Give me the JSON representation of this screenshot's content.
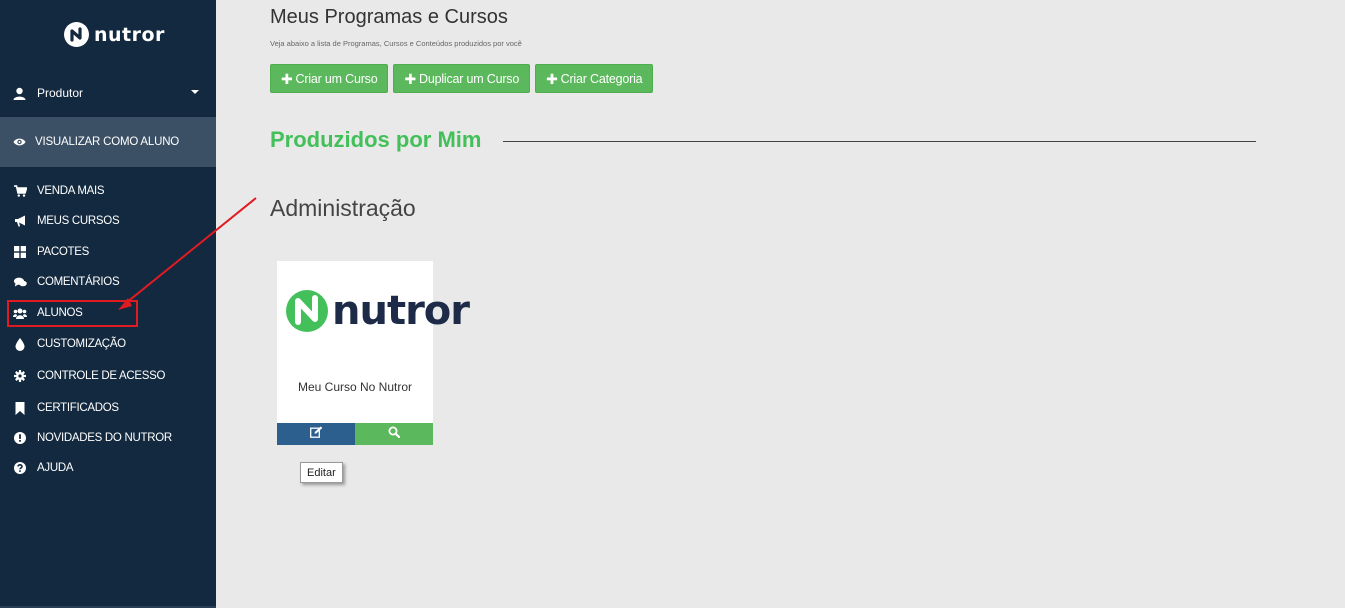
{
  "brand": {
    "name": "nutror"
  },
  "sidebar": {
    "profile_label": "Produtor",
    "view_as_label": "VISUALIZAR COMO ALUNO",
    "items": [
      {
        "label": "VENDA MAIS",
        "icon": "cart-icon"
      },
      {
        "label": "MEUS CURSOS",
        "icon": "bullhorn-icon"
      },
      {
        "label": "PACOTES",
        "icon": "grid-icon"
      },
      {
        "label": "COMENTÁRIOS",
        "icon": "comments-icon"
      },
      {
        "label": "ALUNOS",
        "icon": "users-icon"
      },
      {
        "label": "CUSTOMIZAÇÃO",
        "icon": "drop-icon"
      },
      {
        "label": "CONTROLE DE ACESSO",
        "icon": "gear-icon"
      },
      {
        "label": "CERTIFICADOS",
        "icon": "bookmark-icon"
      },
      {
        "label": "NOVIDADES DO NUTROR",
        "icon": "exclamation-icon"
      },
      {
        "label": "AJUDA",
        "icon": "question-icon"
      }
    ],
    "highlighted_item": "ALUNOS",
    "highlight_color": "#e01b22"
  },
  "main": {
    "title": "Meus Programas e Cursos",
    "subtitle": "Veja abaixo a lista de Programas, Cursos e Conteúdos produzidos por você",
    "buttons": {
      "create_course": "Criar um Curso",
      "duplicate_course": "Duplicar um Curso",
      "create_category": "Criar Categoria"
    },
    "section_title": "Produzidos por Mim",
    "category_title": "Administração",
    "course_card": {
      "logo_text": "nutror",
      "name": "Meu Curso No Nutror"
    },
    "tooltip": "Editar"
  },
  "colors": {
    "sidebar_bg": "#13293f",
    "accent_green": "#5cb85c",
    "section_green": "#43c05a",
    "edit_blue": "#2d5f8e"
  }
}
